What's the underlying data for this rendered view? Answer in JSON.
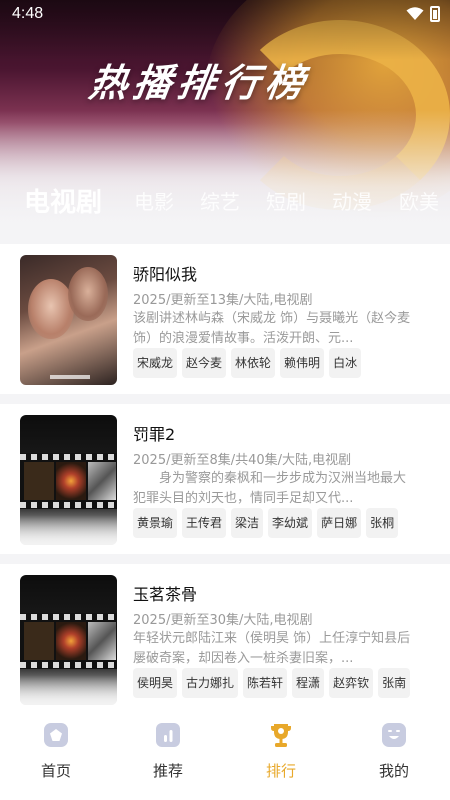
{
  "status_bar": {
    "time": "4:48"
  },
  "header": {
    "title": "热播排行榜"
  },
  "tabs": [
    {
      "label": "电视剧",
      "active": true
    },
    {
      "label": "电影",
      "active": false
    },
    {
      "label": "综艺",
      "active": false
    },
    {
      "label": "短剧",
      "active": false
    },
    {
      "label": "动漫",
      "active": false
    },
    {
      "label": "欧美",
      "active": false
    }
  ],
  "list": [
    {
      "title": "骄阳似我",
      "meta": "2025/更新至13集/大陆,电视剧",
      "description": "该剧讲述林屿森（宋威龙 饰）与聂曦光（赵今麦 饰）的浪漫爱情故事。活泼开朗、元...",
      "tags": [
        "宋威龙",
        "赵今麦",
        "林依轮",
        "赖伟明",
        "白冰"
      ]
    },
    {
      "title": "罚罪2",
      "meta": "2025/更新至8集/共40集/大陆,电视剧",
      "description": "　　身为警察的秦枫和一步步成为汉洲当地最大犯罪头目的刘天也，情同手足却又代...",
      "tags": [
        "黄景瑜",
        "王传君",
        "梁洁",
        "李幼斌",
        "萨日娜",
        "张桐"
      ]
    },
    {
      "title": "玉茗茶骨",
      "meta": "2025/更新至30集/大陆,电视剧",
      "description": "年轻状元郎陆江来（侯明昊 饰）上任淳宁知县后屡破奇案，却因卷入一桩杀妻旧案，...",
      "tags": [
        "侯明昊",
        "古力娜扎",
        "陈若轩",
        "程潇",
        "赵弈钦",
        "张南"
      ]
    }
  ],
  "bottom_nav": [
    {
      "label": "首页",
      "icon": "home-icon",
      "active": false
    },
    {
      "label": "推荐",
      "icon": "chart-icon",
      "active": false
    },
    {
      "label": "排行",
      "icon": "trophy-icon",
      "active": true
    },
    {
      "label": "我的",
      "icon": "profile-icon",
      "active": false
    }
  ],
  "colors": {
    "accent": "#e8a82a",
    "nav_icon": "#c8cce0",
    "meta_text": "#999999"
  }
}
